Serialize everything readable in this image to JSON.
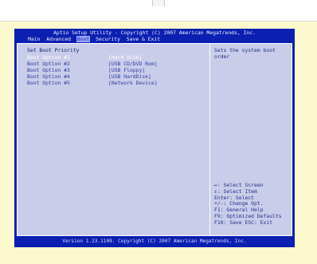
{
  "bios": {
    "title": "Aptio Setup Utility - Copyright (C) 2007 American Megatrends, Inc.",
    "tabs": [
      {
        "label": "Main",
        "active": false
      },
      {
        "label": "Advanced",
        "active": false
      },
      {
        "label": "Boot",
        "active": true
      },
      {
        "label": "Security",
        "active": false
      },
      {
        "label": "Save & Exit",
        "active": false
      }
    ],
    "section_title": "Set Boot Priority",
    "options": [
      {
        "label": "Boot Option #1",
        "value": "[Hard Disk]",
        "selected": true
      },
      {
        "label": "Boot Option #2",
        "value": "[USB CD/DVD Rom]",
        "selected": false
      },
      {
        "label": "Boot Option #3",
        "value": "[USB Floppy]",
        "selected": false
      },
      {
        "label": "Boot Option #4",
        "value": "[USB HardDisk]",
        "selected": false
      },
      {
        "label": "Boot Option #5",
        "value": "[Network Device]",
        "selected": false
      }
    ],
    "help_text": "Sets the system boot order",
    "keys": [
      "↔: Select Screen",
      "↕: Select Item",
      "Enter: Select",
      "+/-: Change Opt.",
      "F1: General Help",
      "F9: Optimized Defaults",
      "F10: Save  ESC: Exit"
    ],
    "footer": "Version 1.23.1109. Copyright (C) 2007 American Megatrends, Inc.",
    "colors": {
      "background": "#0b1fb0",
      "panel": "#c9cdea",
      "highlight_tab": "#9ea6ff",
      "page_bg": "#fcf9cf"
    }
  }
}
